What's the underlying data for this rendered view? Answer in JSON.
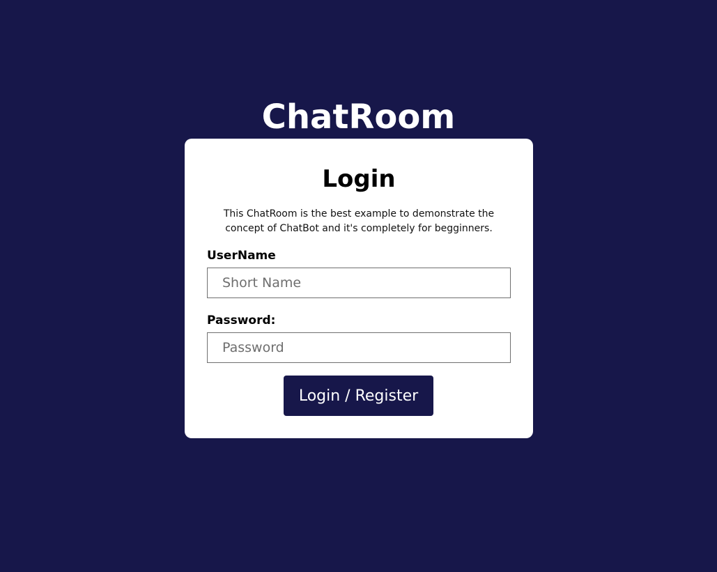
{
  "app": {
    "title": "ChatRoom"
  },
  "login_card": {
    "title": "Login",
    "description": "This ChatRoom is the best example to demonstrate the concept of ChatBot and it's completely for begginners.",
    "username": {
      "label": "UserName",
      "placeholder": "Short Name",
      "value": ""
    },
    "password": {
      "label": "Password:",
      "placeholder": "Password",
      "value": ""
    },
    "submit_label": "Login / Register"
  },
  "colors": {
    "background": "#17174a",
    "card": "#ffffff",
    "button": "#17174a",
    "button_text": "#ffffff"
  }
}
